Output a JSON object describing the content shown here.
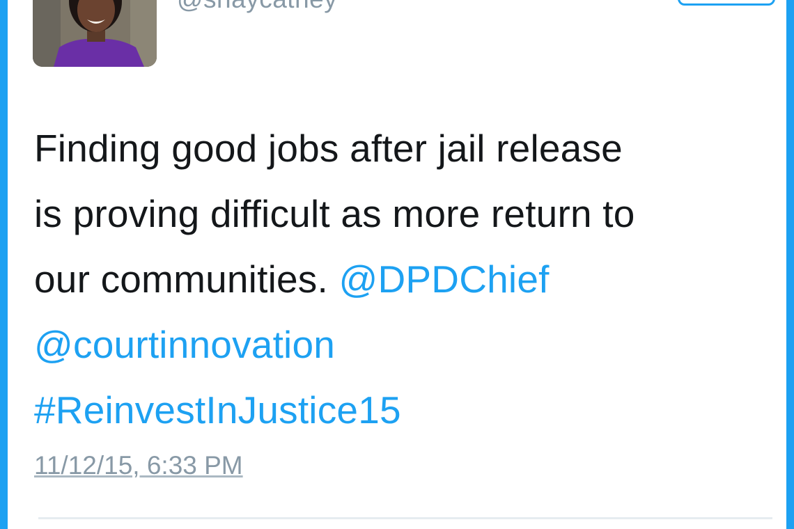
{
  "tweet": {
    "handle": "@shaycatney",
    "text_plain": [
      "Finding good jobs after jail release",
      "is proving difficult as more return to",
      "our communities. "
    ],
    "mentions": {
      "dpd_chief": "@DPDChief",
      "court_innovation": "@courtinnovation"
    },
    "hashtag": "#ReinvestInJustice15",
    "timestamp": "11/12/15, 6:33 PM"
  },
  "colors": {
    "accent": "#1da1f2",
    "text": "#14171a",
    "muted": "#8899a6",
    "divider": "#e6ecf0"
  },
  "icons": {
    "avatar": "profile-photo"
  }
}
